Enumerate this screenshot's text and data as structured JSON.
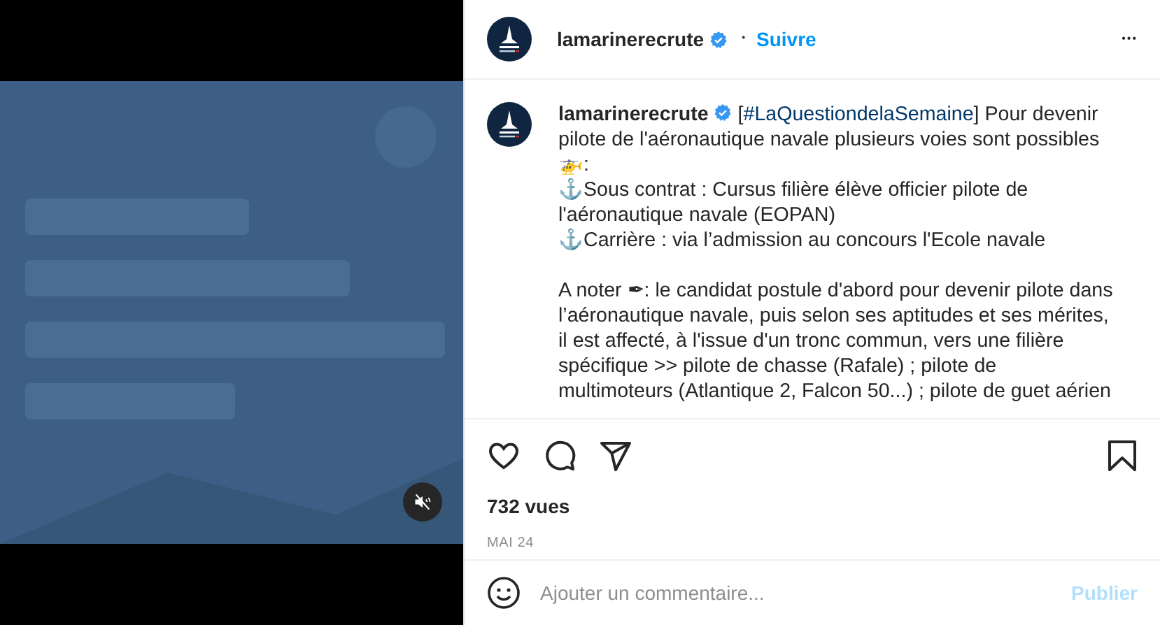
{
  "video": {
    "kind": "picture",
    "muted": true
  },
  "header": {
    "username": "lamarinerecrute",
    "verified": true,
    "separator": "•",
    "follow": "Suivre",
    "more": "•••"
  },
  "caption": {
    "username": "lamarinerecrute",
    "verified": true,
    "before": "[",
    "hashtag": "#LaQuestiondelaSemaine",
    "text": "] Pour devenir pilote de l'aéronautique navale plusieurs voies sont possibles 🚁:\n⚓Sous contrat : Cursus filière élève officier pilote de l'aéronautique navale (EOPAN)\n⚓Carrière : via l’admission au concours l'Ecole navale\n\nA noter ✒: le candidat postule d'abord pour devenir pilote dans l’aéronautique navale, puis selon ses aptitudes et ses mérites, il est affecté, à l'issue d'un tronc commun, vers une filière spécifique >> pilote de chasse (Rafale) ; pilote de multimoteurs (Atlantique 2, Falcon 50...) ; pilote de guet aérien"
  },
  "actions": {
    "liked": false,
    "saved": false
  },
  "views": "732 vues",
  "date": "MAI 24",
  "comment": {
    "placeholder": "Ajouter un commentaire...",
    "submit": "Publier",
    "disabled": true
  }
}
